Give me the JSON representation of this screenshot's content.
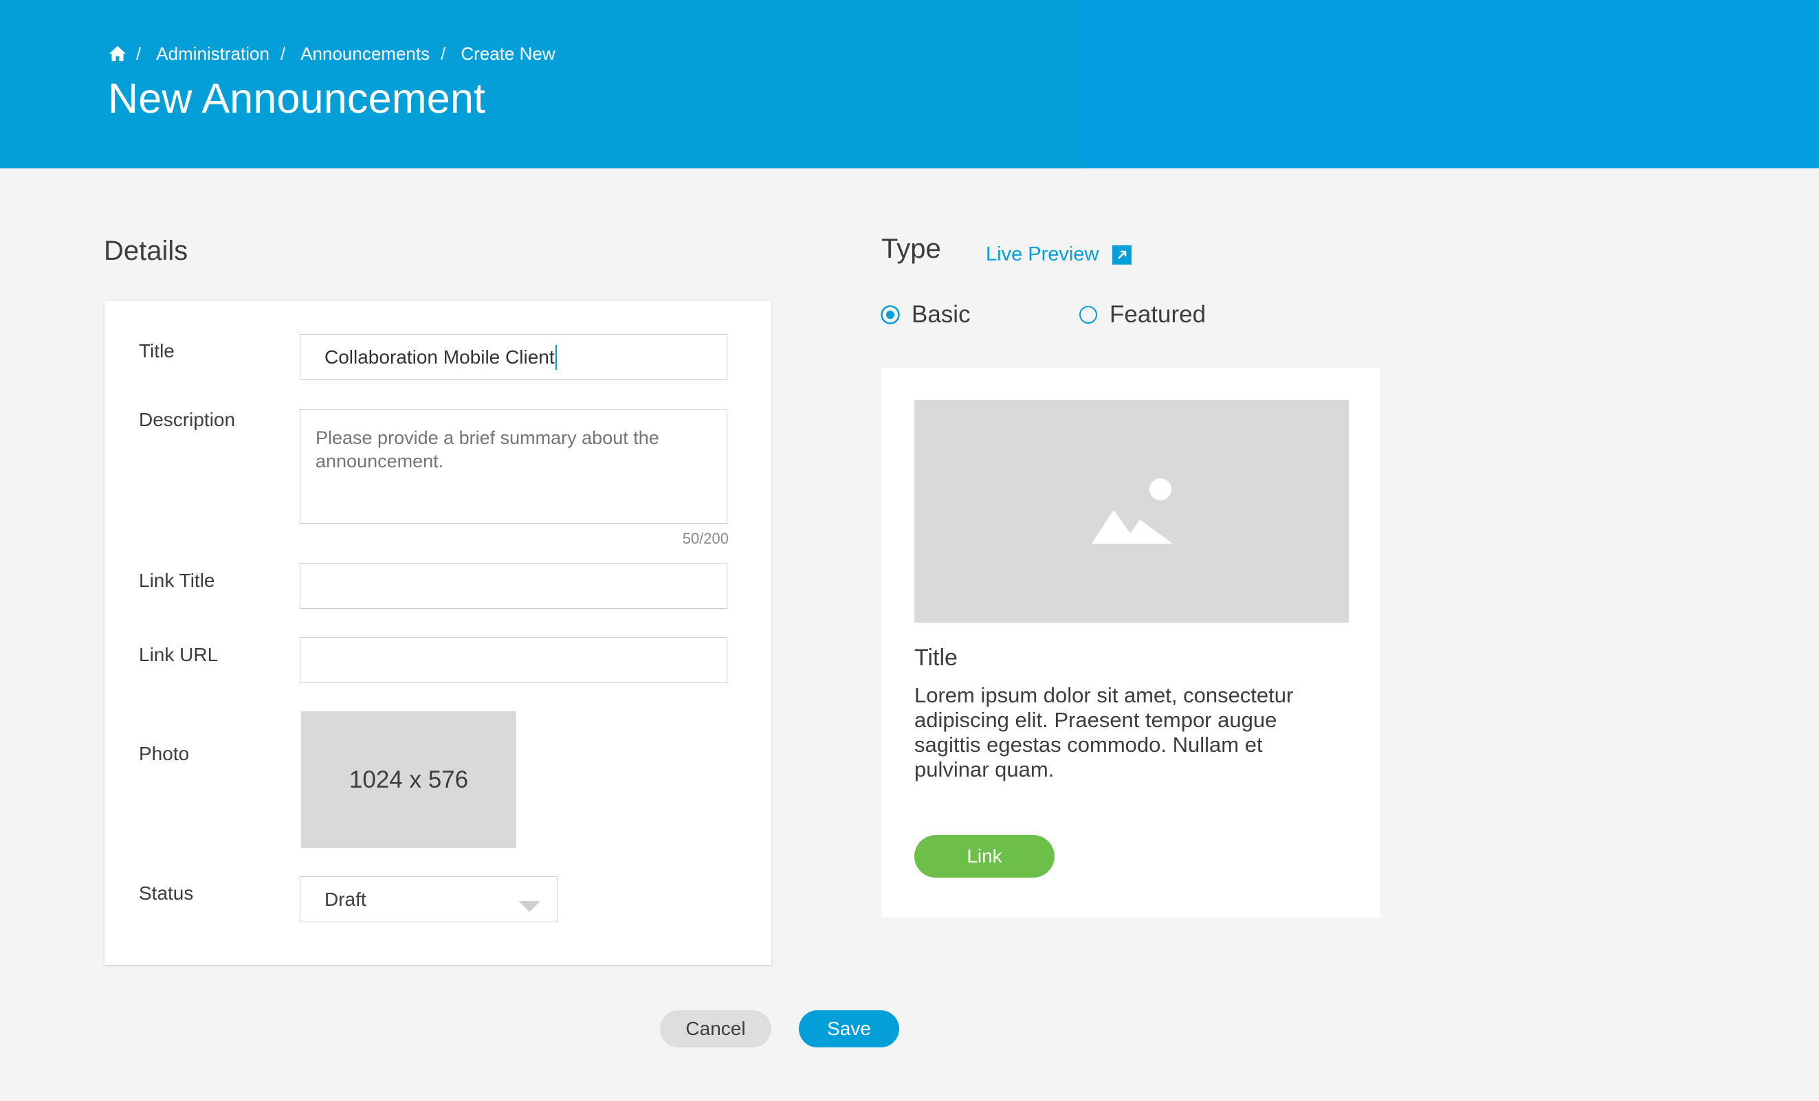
{
  "header": {
    "breadcrumb": {
      "home_icon": "home-icon",
      "separator": "/",
      "items": [
        "Administration",
        "Announcements",
        "Create New"
      ]
    },
    "title": "New Announcement",
    "colors": {
      "background": "#049fd9"
    }
  },
  "details": {
    "heading": "Details",
    "title_label": "Title",
    "title_value": "Collaboration Mobile Client",
    "description_label": "Description",
    "description_placeholder": "Please provide a brief summary about the announcement.",
    "description_count": "50/200",
    "link_title_label": "Link Title",
    "link_title_value": "",
    "link_url_label": "Link URL",
    "link_url_value": "",
    "photo_label": "Photo",
    "photo_size": "1024 x 576",
    "status_label": "Status",
    "status_value": "Draft"
  },
  "type": {
    "heading": "Type",
    "live_preview_label": "Live Preview",
    "live_preview_icon": "external-link-icon",
    "options": [
      {
        "label": "Basic",
        "selected": true
      },
      {
        "label": "Featured",
        "selected": false
      }
    ]
  },
  "preview": {
    "image_icon": "image-placeholder-icon",
    "title": "Title",
    "body": "Lorem ipsum dolor sit amet, consectetur adipiscing elit. Praesent tempor augue sagittis egestas commodo. Nullam et pulvinar quam.",
    "link_label": "Link",
    "colors": {
      "link_button": "#6cc04a"
    }
  },
  "actions": {
    "cancel_label": "Cancel",
    "save_label": "Save",
    "colors": {
      "save": "#049fd9",
      "cancel": "#dedede"
    }
  }
}
